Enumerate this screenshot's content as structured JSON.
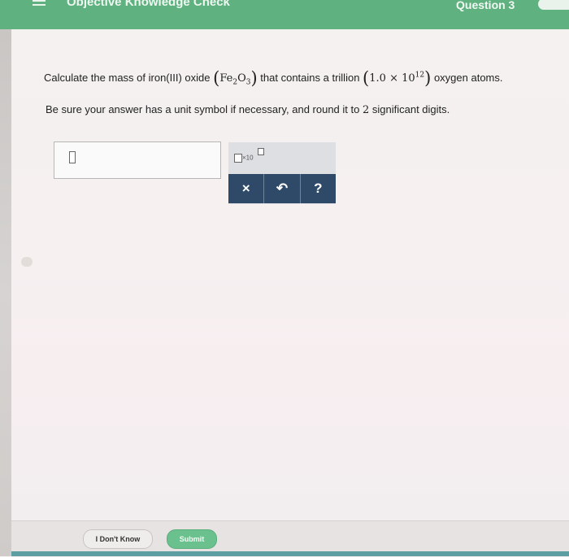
{
  "header": {
    "title": "Objective Knowledge Check",
    "question_label": "Question 3",
    "menu_icon": "hamburger-menu-icon",
    "toggle_icon": "toggle-switch"
  },
  "question": {
    "part1": "Calculate the mass of iron(III) oxide",
    "formula_fe": "Fe",
    "formula_fe_sub": "2",
    "formula_o": "O",
    "formula_o_sub": "3",
    "part2": "that contains a trillion",
    "coef": "1.0",
    "times": "×",
    "base": "10",
    "exponent": "12",
    "part3": "oxygen atoms.",
    "instruction_pre": "Be sure your answer has a unit symbol if necessary, and round it to",
    "instruction_num": "2",
    "instruction_post": "significant digits."
  },
  "answer": {
    "value": ""
  },
  "keypad": {
    "sci_label": "×10",
    "clear_label": "×",
    "undo_label": "↶",
    "help_label": "?"
  },
  "footer": {
    "dont_know": "I Don't Know",
    "submit": "Submit"
  },
  "colors": {
    "header_green": "#5fb27f",
    "keypad_navy": "#2f4a68",
    "submit_green": "#6bc18e"
  }
}
